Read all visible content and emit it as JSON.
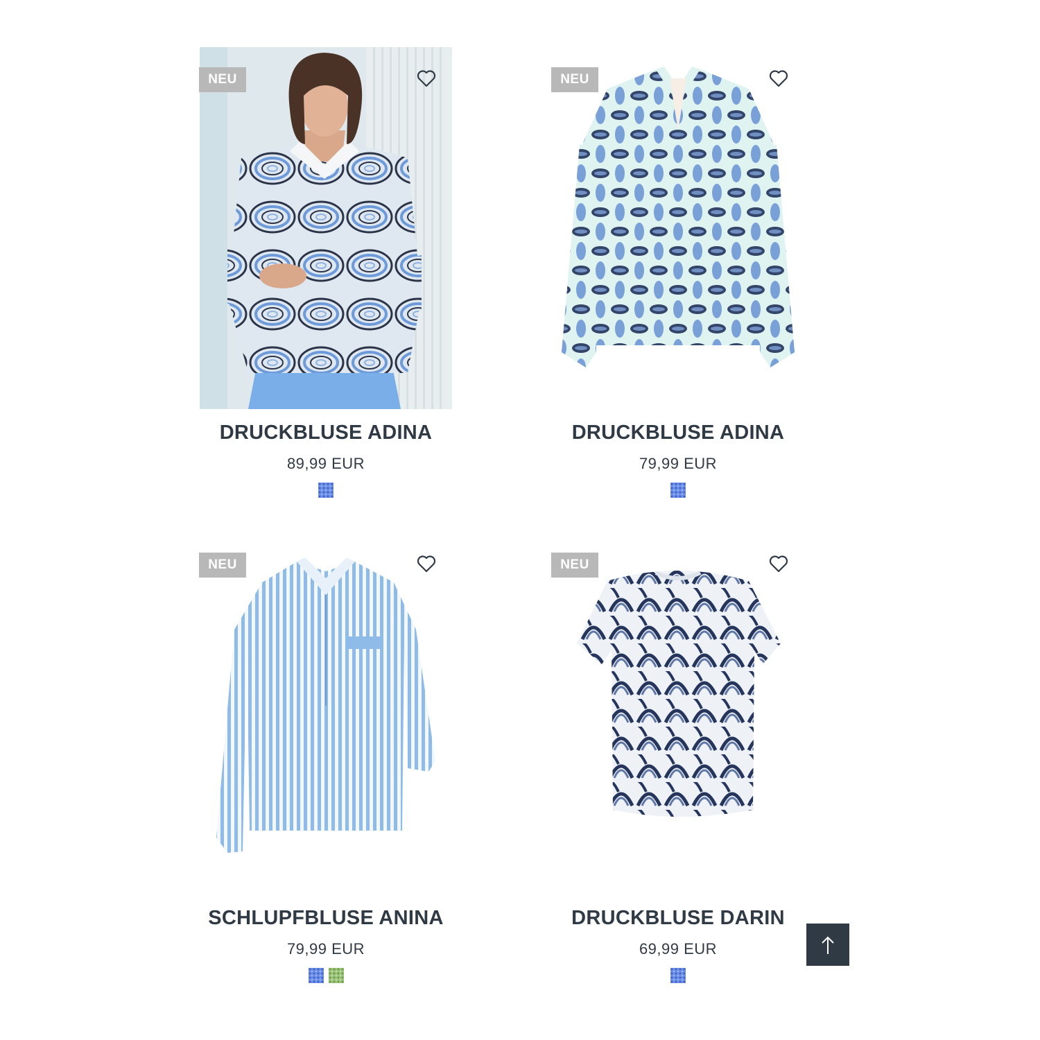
{
  "products": [
    {
      "badge": "NEU",
      "name": "DRUCKBLUSE ADINA",
      "price": "89,99 EUR",
      "swatches": [
        "#5b86e0"
      ]
    },
    {
      "badge": "NEU",
      "name": "DRUCKBLUSE ADINA",
      "price": "79,99 EUR",
      "swatches": [
        "#5b86e0"
      ]
    },
    {
      "badge": "NEU",
      "name": "SCHLUPFBLUSE ANINA",
      "price": "79,99 EUR",
      "swatches": [
        "#5b86e0",
        "#8ab86a"
      ]
    },
    {
      "badge": "NEU",
      "name": "DRUCKBLUSE DARIN",
      "price": "69,99 EUR",
      "swatches": [
        "#5b86e0"
      ]
    }
  ],
  "icons": {
    "favorite": "heart-outline-icon",
    "scroll_top": "arrow-up-icon"
  },
  "colors": {
    "text": "#2f3a44",
    "badge_bg": "#b8b8b8",
    "button_bg": "#2f3a44"
  }
}
